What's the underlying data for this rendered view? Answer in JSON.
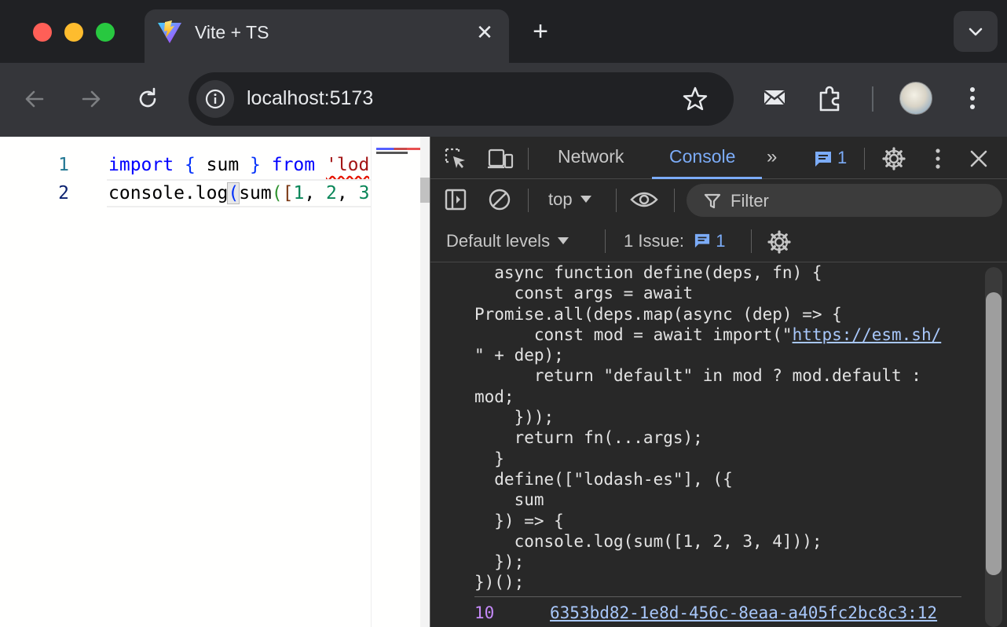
{
  "browser": {
    "tab_title": "Vite + TS",
    "tab_close": "✕",
    "new_tab": "+",
    "url": "localhost:5173"
  },
  "editor": {
    "line_numbers": [
      "1",
      "2"
    ],
    "line1": {
      "kw_import": "import",
      "open": " { ",
      "ident": "sum",
      "close": " } ",
      "kw_from": "from",
      "space": " ",
      "string": "'lod"
    },
    "line2": {
      "ident": "console.log",
      "paren": "(",
      "fn": "sum",
      "paren2": "(",
      "bracket": "[",
      "n1": "1",
      "comma1": ", ",
      "n2": "2",
      "comma2": ", ",
      "n3": "3"
    }
  },
  "devtools": {
    "tabs": {
      "network": "Network",
      "console": "Console",
      "more": "»"
    },
    "message_count": "1",
    "context": "top",
    "filter_placeholder": "Filter",
    "levels": "Default levels",
    "issues_label": "1 Issue:",
    "issues_count": "1",
    "console_code_before_link": "  async function define(deps, fn) {\n    const args = await\nPromise.all(deps.map(async (dep) => {\n      const mod = await import(\"",
    "console_link": "https://esm.sh/",
    "console_code_after_link": "\n\" + dep);\n      return \"default\" in mod ? mod.default :\nmod;\n    }));\n    return fn(...args);\n  }\n  define([\"lodash-es\"], ({\n    sum\n  }) => {\n    console.log(sum([1, 2, 3, 4]));\n  });\n})();",
    "log_value": "10",
    "log_source": "6353bd82-1e8d-456c-8eaa-a405fc2bc8c3:12"
  },
  "colors": {
    "accent_blue": "#7cacf8",
    "log_number": "#c58af9",
    "link": "#a8c7fa"
  },
  "icons": [
    "vite-logo-icon",
    "close-icon",
    "plus-icon",
    "chevron-down-icon",
    "back-arrow-icon",
    "forward-arrow-icon",
    "reload-icon",
    "info-icon",
    "star-icon",
    "mail-icon",
    "extensions-icon",
    "kebab-menu-icon",
    "inspect-icon",
    "device-toolbar-icon",
    "settings-icon",
    "sidebar-icon",
    "clear-icon",
    "eye-icon",
    "filter-icon"
  ]
}
